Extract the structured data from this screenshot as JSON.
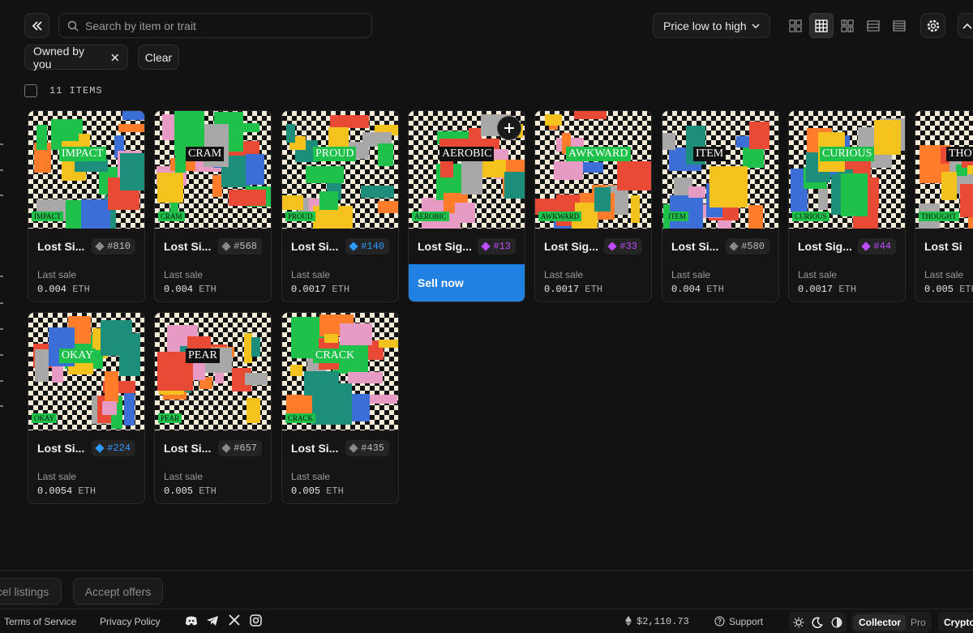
{
  "search": {
    "placeholder": "Search by item or trait"
  },
  "sort": {
    "selected": "Price low to high"
  },
  "filters": {
    "owned_chip": "Owned by you",
    "clear_label": "Clear"
  },
  "items_count": "11 ITEMS",
  "colors": {
    "accent_blue": "#2081e2",
    "gem_grey": "#8a8a8a",
    "gem_blue": "#2e9bff",
    "gem_purple": "#c04dff"
  },
  "cards": [
    {
      "name": "Lost Si...",
      "id": "#810",
      "gem": "grey",
      "word": "IMPACT",
      "last_sale_label": "Last sale",
      "price": "0.004",
      "currency": "ETH"
    },
    {
      "name": "Lost Si...",
      "id": "#568",
      "gem": "grey",
      "word": "CRAM",
      "last_sale_label": "Last sale",
      "price": "0.004",
      "currency": "ETH"
    },
    {
      "name": "Lost Si...",
      "id": "#140",
      "gem": "blue",
      "word": "PROUD",
      "last_sale_label": "Last sale",
      "price": "0.0017",
      "currency": "ETH"
    },
    {
      "name": "Lost Sig...",
      "id": "#13",
      "gem": "purple",
      "word": "AEROBIC",
      "sell_label": "Sell now"
    },
    {
      "name": "Lost Sig...",
      "id": "#33",
      "gem": "purple",
      "word": "AWKWARD",
      "last_sale_label": "Last sale",
      "price": "0.0017",
      "currency": "ETH"
    },
    {
      "name": "Lost Si...",
      "id": "#580",
      "gem": "grey",
      "word": "ITEM",
      "last_sale_label": "Last sale",
      "price": "0.004",
      "currency": "ETH"
    },
    {
      "name": "Lost Sig...",
      "id": "#44",
      "gem": "purple",
      "word": "CURIOUS",
      "last_sale_label": "Last sale",
      "price": "0.0017",
      "currency": "ETH"
    },
    {
      "name": "Lost Si",
      "id": "",
      "gem": "",
      "word": "THOUGHT",
      "last_sale_label": "Last sale",
      "price": "0.005",
      "currency": "ETH"
    },
    {
      "name": "Lost Si...",
      "id": "#224",
      "gem": "blue",
      "word": "OKAY",
      "last_sale_label": "Last sale",
      "price": "0.0054",
      "currency": "ETH"
    },
    {
      "name": "Lost Si...",
      "id": "#657",
      "gem": "grey",
      "word": "PEAR",
      "last_sale_label": "Last sale",
      "price": "0.005",
      "currency": "ETH"
    },
    {
      "name": "Lost Si...",
      "id": "#435",
      "gem": "grey",
      "word": "CRACK",
      "last_sale_label": "Last sale",
      "price": "0.005",
      "currency": "ETH"
    }
  ],
  "actions": {
    "cancel_listings": "cel listings",
    "accept_offers": "Accept offers"
  },
  "footer": {
    "terms": "Terms of Service",
    "privacy": "Privacy Policy",
    "eth_price": "$2,110.73",
    "support": "Support",
    "role_active": "Collector",
    "role_inactive": "Pro",
    "crypto": "Crypto"
  }
}
